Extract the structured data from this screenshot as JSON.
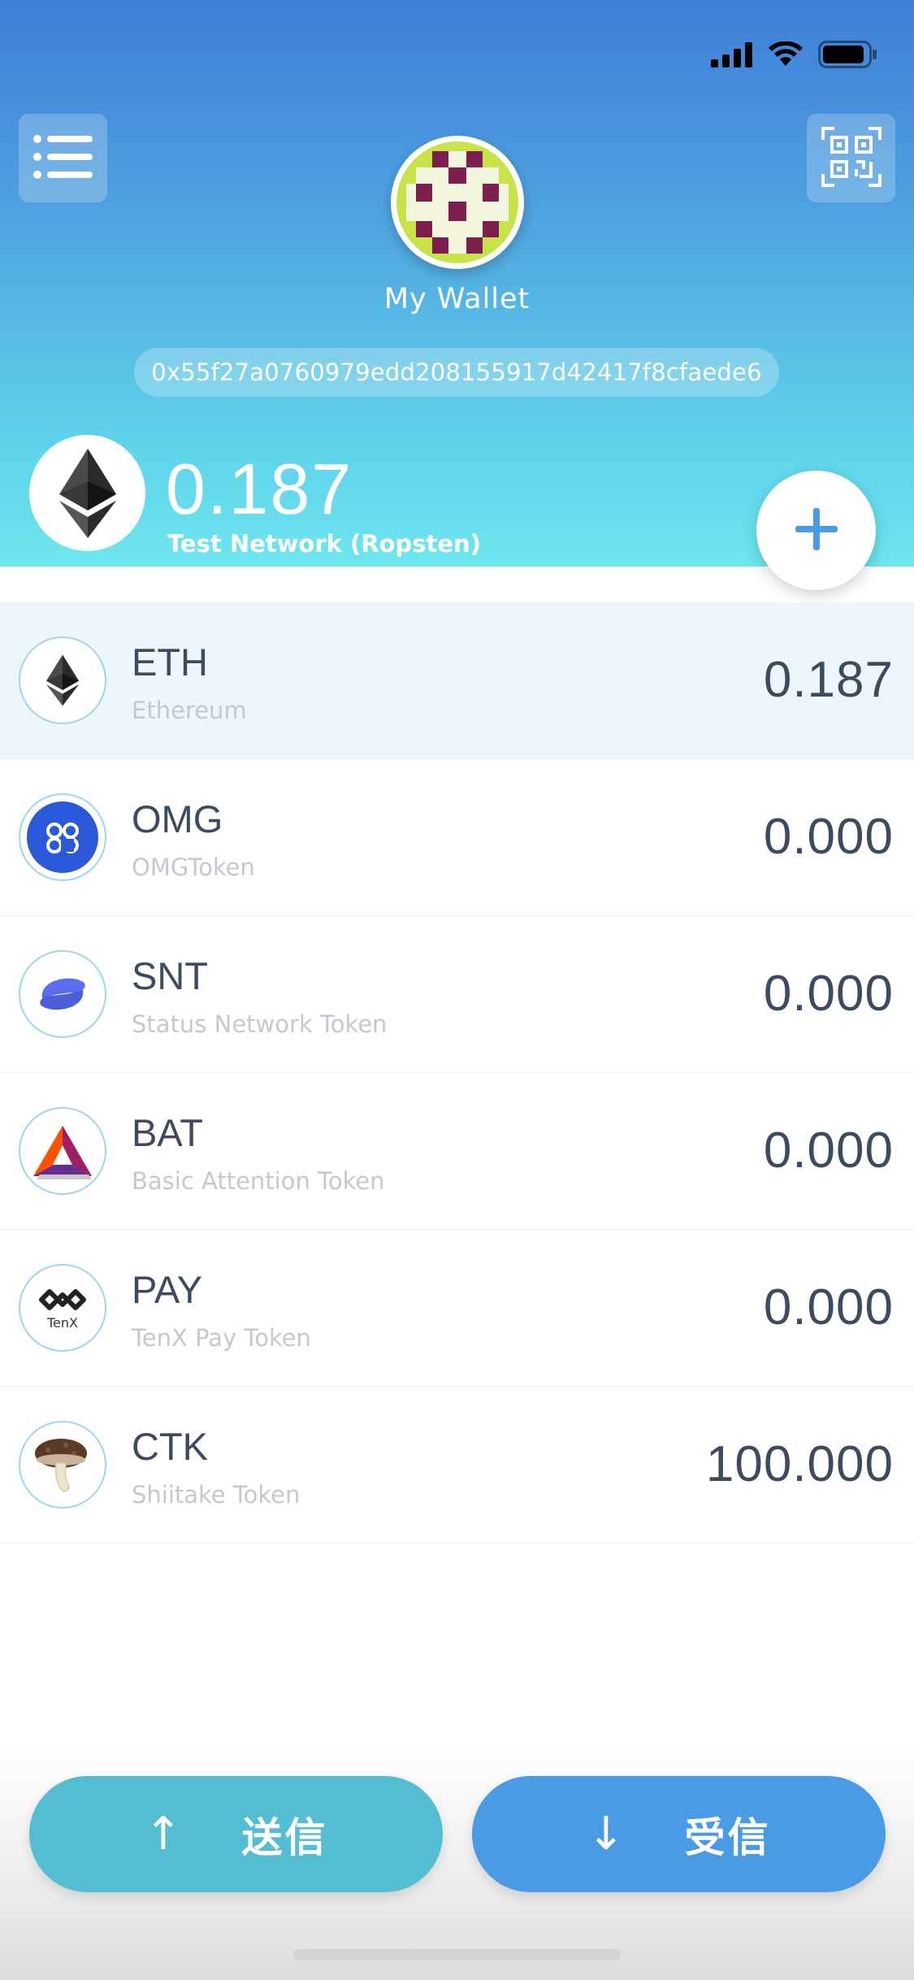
{
  "header": {
    "wallet_name": "My Wallet",
    "address": "0x55f27a0760979edd208155917d42417f8cfaede6",
    "balance": "0.187",
    "network": "Test Network (Ropsten)"
  },
  "tokens": [
    {
      "symbol": "ETH",
      "name": "Ethereum",
      "amount": "0.187",
      "icon": "ethereum-icon"
    },
    {
      "symbol": "OMG",
      "name": "OMGToken",
      "amount": "0.000",
      "icon": "omisego-icon"
    },
    {
      "symbol": "SNT",
      "name": "Status Network Token",
      "amount": "0.000",
      "icon": "status-icon"
    },
    {
      "symbol": "BAT",
      "name": "Basic Attention Token",
      "amount": "0.000",
      "icon": "bat-icon"
    },
    {
      "symbol": "PAY",
      "name": "TenX Pay Token",
      "amount": "0.000",
      "icon": "tenx-icon",
      "icon_text": "TenX"
    },
    {
      "symbol": "CTK",
      "name": "Shiitake Token",
      "amount": "100.000",
      "icon": "shiitake-icon"
    }
  ],
  "actions": {
    "send_label": "送信",
    "send_arrow": "↑",
    "receive_label": "受信",
    "receive_arrow": "↓"
  },
  "colors": {
    "header_gradient_top": "#3f7fd8",
    "header_gradient_bottom": "#6ee6ee",
    "send_button": "#55bdd2",
    "receive_button": "#4a9be6",
    "accent": "#4a9be6",
    "selected_row": "#eef6fd"
  }
}
